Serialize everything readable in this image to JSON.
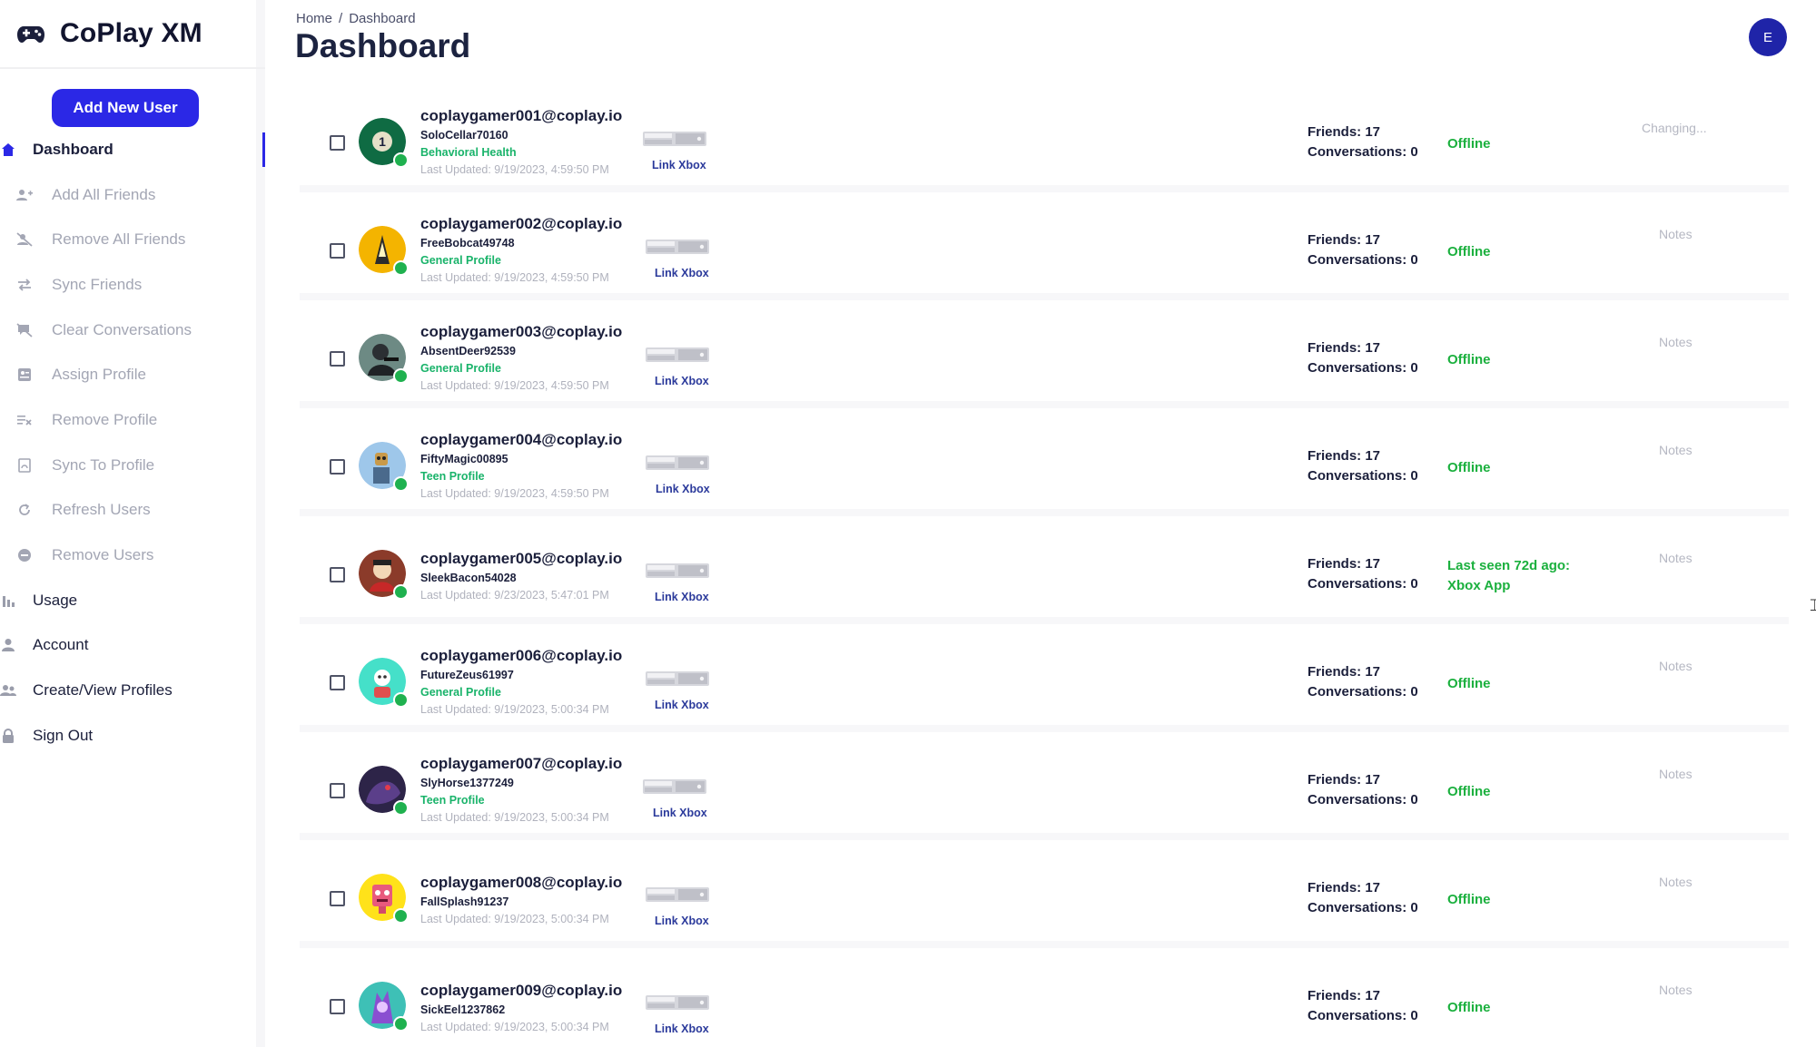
{
  "app": {
    "name": "CoPlay XM"
  },
  "sidebar": {
    "add_user_label": "Add New User",
    "items": [
      {
        "label": "Dashboard",
        "icon": "home-icon",
        "level": "main",
        "active": true
      },
      {
        "label": "Add All Friends",
        "icon": "add-friends-icon",
        "level": "sub"
      },
      {
        "label": "Remove All Friends",
        "icon": "remove-friends-icon",
        "level": "sub"
      },
      {
        "label": "Sync Friends",
        "icon": "sync-arrows-icon",
        "level": "sub"
      },
      {
        "label": "Clear Conversations",
        "icon": "clear-chat-icon",
        "level": "sub"
      },
      {
        "label": "Assign Profile",
        "icon": "assign-profile-icon",
        "level": "sub"
      },
      {
        "label": "Remove Profile",
        "icon": "remove-profile-icon",
        "level": "sub"
      },
      {
        "label": "Sync To Profile",
        "icon": "sync-profile-icon",
        "level": "sub"
      },
      {
        "label": "Refresh Users",
        "icon": "refresh-icon",
        "level": "sub"
      },
      {
        "label": "Remove Users",
        "icon": "minus-circle-icon",
        "level": "sub"
      },
      {
        "label": "Usage",
        "icon": "bar-chart-icon",
        "level": "main"
      },
      {
        "label": "Account",
        "icon": "person-icon",
        "level": "main"
      },
      {
        "label": "Create/View Profiles",
        "icon": "people-icon",
        "level": "main"
      },
      {
        "label": "Sign Out",
        "icon": "lock-icon",
        "level": "main"
      }
    ]
  },
  "header": {
    "breadcrumb": {
      "home": "Home",
      "separator": "/",
      "current": "Dashboard"
    },
    "title": "Dashboard",
    "avatar_initial": "E"
  },
  "users": [
    {
      "email": "coplaygamer001@coplay.io",
      "gamertag": "SoloCellar70160",
      "profile": "Behavioral Health",
      "updated": "Last Updated: 9/19/2023, 4:59:50 PM",
      "link": "Link Xbox",
      "friends": "Friends: 17",
      "conversations": "Conversations: 0",
      "status": [
        "Offline"
      ],
      "notes": "Changing...",
      "avatar_icon": "number-one-avatar-icon"
    },
    {
      "email": "coplaygamer002@coplay.io",
      "gamertag": "FreeBobcat49748",
      "profile": "General Profile",
      "updated": "Last Updated: 9/19/2023, 4:59:50 PM",
      "link": "Link Xbox",
      "friends": "Friends: 17",
      "conversations": "Conversations: 0",
      "status": [
        "Offline"
      ],
      "notes": "Notes",
      "avatar_icon": "yellow-character-avatar-icon"
    },
    {
      "email": "coplaygamer003@coplay.io",
      "gamertag": "AbsentDeer92539",
      "profile": "General Profile",
      "updated": "Last Updated: 9/19/2023, 4:59:50 PM",
      "link": "Link Xbox",
      "friends": "Friends: 17",
      "conversations": "Conversations: 0",
      "status": [
        "Offline"
      ],
      "notes": "Notes",
      "avatar_icon": "soldier-avatar-icon"
    },
    {
      "email": "coplaygamer004@coplay.io",
      "gamertag": "FiftyMagic00895",
      "profile": "Teen Profile",
      "updated": "Last Updated: 9/19/2023, 4:59:50 PM",
      "link": "Link Xbox",
      "friends": "Friends: 17",
      "conversations": "Conversations: 0",
      "status": [
        "Offline"
      ],
      "notes": "Notes",
      "avatar_icon": "robot-avatar-icon"
    },
    {
      "email": "coplaygamer005@coplay.io",
      "gamertag": "SleekBacon54028",
      "profile": "",
      "updated": "Last Updated: 9/23/2023, 5:47:01 PM",
      "link": "Link Xbox",
      "friends": "Friends: 17",
      "conversations": "Conversations: 0",
      "status": [
        "Last seen 72d ago:",
        "Xbox App"
      ],
      "notes": "Notes",
      "avatar_icon": "red-character-avatar-icon"
    },
    {
      "email": "coplaygamer006@coplay.io",
      "gamertag": "FutureZeus61997",
      "profile": "General Profile",
      "updated": "Last Updated: 9/19/2023, 5:00:34 PM",
      "link": "Link Xbox",
      "friends": "Friends: 17",
      "conversations": "Conversations: 0",
      "status": [
        "Offline"
      ],
      "notes": "Notes",
      "avatar_icon": "cyan-character-avatar-icon"
    },
    {
      "email": "coplaygamer007@coplay.io",
      "gamertag": "SlyHorse1377249",
      "profile": "Teen Profile",
      "updated": "Last Updated: 9/19/2023, 5:00:34 PM",
      "link": "Link Xbox",
      "friends": "Friends: 17",
      "conversations": "Conversations: 0",
      "status": [
        "Offline"
      ],
      "notes": "Notes",
      "avatar_icon": "dark-creature-avatar-icon"
    },
    {
      "email": "coplaygamer008@coplay.io",
      "gamertag": "FallSplash91237",
      "profile": "",
      "updated": "Last Updated: 9/19/2023, 5:00:34 PM",
      "link": "Link Xbox",
      "friends": "Friends: 17",
      "conversations": "Conversations: 0",
      "status": [
        "Offline"
      ],
      "notes": "Notes",
      "avatar_icon": "pink-robot-avatar-icon"
    },
    {
      "email": "coplaygamer009@coplay.io",
      "gamertag": "SickEel1237862",
      "profile": "",
      "updated": "Last Updated: 9/19/2023, 5:00:34 PM",
      "link": "Link Xbox",
      "friends": "Friends: 17",
      "conversations": "Conversations: 0",
      "status": [
        "Offline"
      ],
      "notes": "Notes",
      "avatar_icon": "purple-character-avatar-icon"
    }
  ],
  "colors": {
    "accent": "#2b28e6",
    "online_dot": "#1fb14f",
    "profile_text": "#19b36a",
    "status_text": "#1bb03e",
    "link_text": "#2b3a9b",
    "avatar_top": "#1f24a8"
  }
}
